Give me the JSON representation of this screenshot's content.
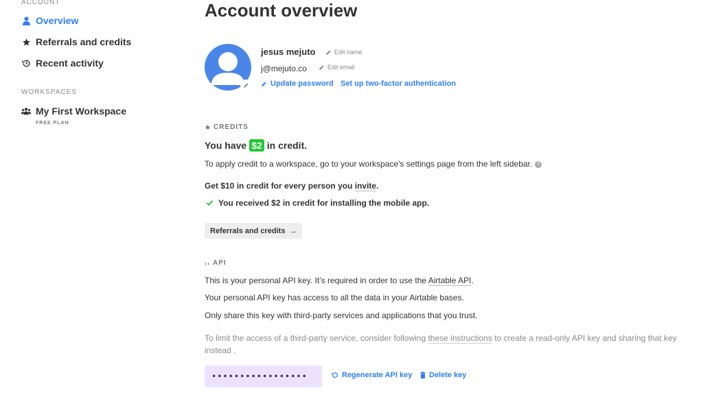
{
  "sidebar": {
    "account_heading": "ACCOUNT",
    "items": [
      {
        "label": "Overview",
        "icon": "person-icon"
      },
      {
        "label": "Referrals and credits",
        "icon": "star-icon"
      },
      {
        "label": "Recent activity",
        "icon": "history-icon"
      }
    ],
    "workspaces_heading": "WORKSPACES",
    "workspace": {
      "label": "My First Workspace",
      "plan": "FREE PLAN",
      "icon": "people-icon"
    }
  },
  "main": {
    "title": "Account overview",
    "user": {
      "name": "jesus mejuto",
      "email": "j@mejuto.co",
      "edit_name": "Edit name",
      "edit_email": "Edit email",
      "update_password": "Update password",
      "two_factor": "Set up two-factor authentication"
    },
    "credits": {
      "heading": "CREDITS",
      "have_prefix": "You have",
      "amount": "$2",
      "have_suffix": "in credit.",
      "apply_text": "To apply credit to a workspace, go to your workspace's settings page from the left sidebar.",
      "get_prefix": "Get $10 in credit for every person you ",
      "get_link": "invite",
      "get_suffix": ".",
      "received": "You received $2 in credit for installing the mobile app.",
      "button": "Referrals and credits"
    },
    "api": {
      "heading": "API",
      "line1_prefix": "This is your personal API key. It’s required in order to use the ",
      "line1_link": "Airtable API",
      "line1_suffix": ".",
      "line2": "Your personal API key has access to all the data in your Airtable bases.",
      "line3": "Only share this key with third-party services and applications that you trust.",
      "muted_prefix": "To limit the access of a third-party service, consider following ",
      "muted_link": "these instructions",
      "muted_suffix": " to create a read-only API key and sharing that key instead .",
      "key_masked": "•••••••••••••••••",
      "regenerate": "Regenerate API key",
      "delete": "Delete key"
    }
  },
  "colors": {
    "accent": "#2d7ff9",
    "avatar": "#4a86e8",
    "credit_green": "#20c933",
    "api_key_bg": "#ede2fe"
  }
}
